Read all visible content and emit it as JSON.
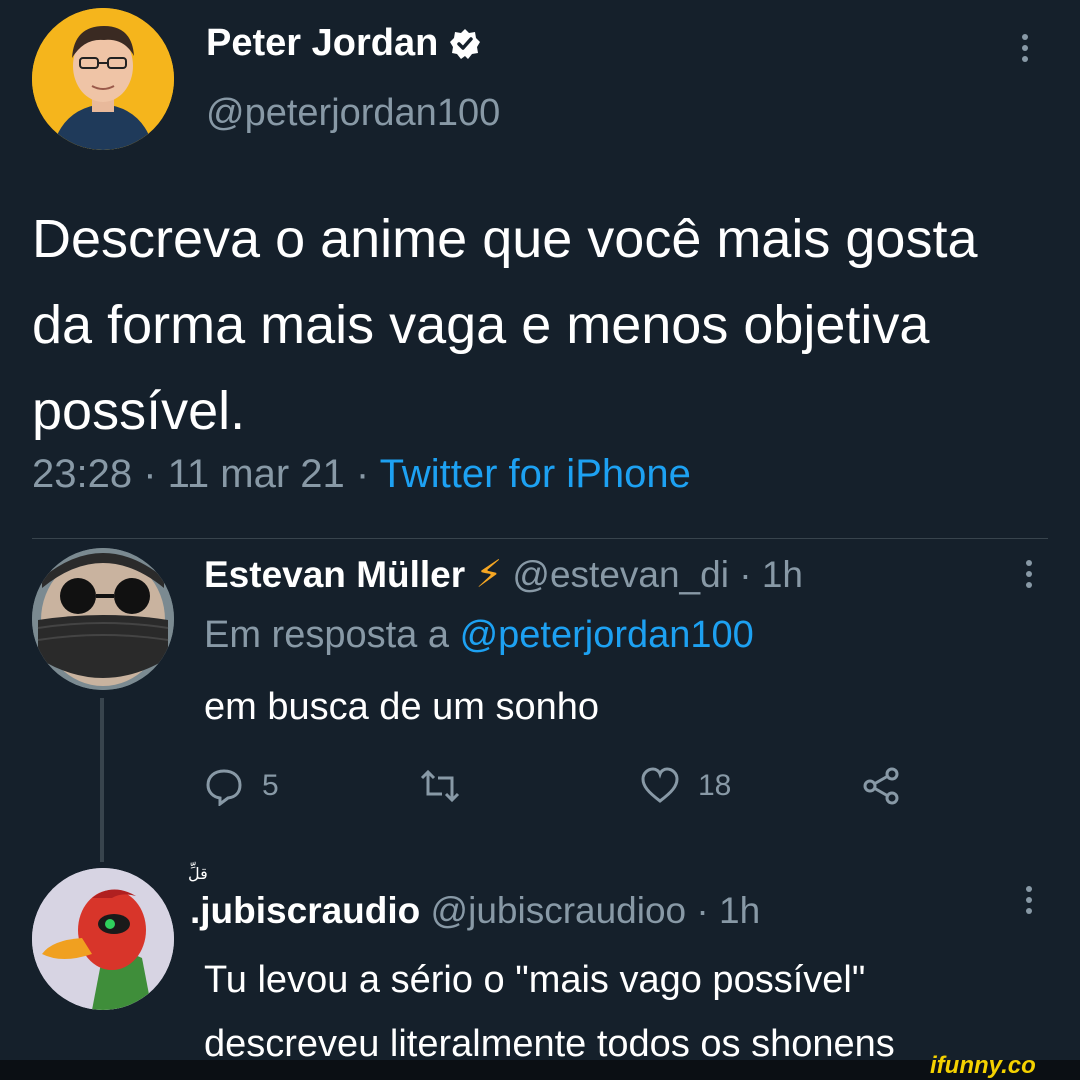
{
  "main_tweet": {
    "author_name": "Peter Jordan",
    "author_handle": "@peterjordan100",
    "text": "Descreva o anime que você mais gosta da forma mais vaga e menos objetiva possível.",
    "time": "23:28 · 11 mar 21 · ",
    "source": "Twitter for iPhone"
  },
  "reply1": {
    "author_name": "Estevan Müller",
    "emoji": "⚡",
    "handle_time": "@estevan_di · 1h",
    "in_reply_prefix": "Em resposta a ",
    "in_reply_mention": "@peterjordan100",
    "text": "em busca de um sonho",
    "reply_count": "5",
    "like_count": "18"
  },
  "reply2": {
    "author_name": ".jubiscraudio",
    "handle_time": "@jubiscraudioo · 1h",
    "name_glyph": "قلِّ",
    "text_line1": "Tu levou a sério o \"mais vago possível\"",
    "text_line2": "descreveu literalmente todos os shonens"
  },
  "watermark": "ifunny.co",
  "colors": {
    "background": "#15202b",
    "secondary_text": "#8899a6",
    "link": "#1da1f2"
  }
}
